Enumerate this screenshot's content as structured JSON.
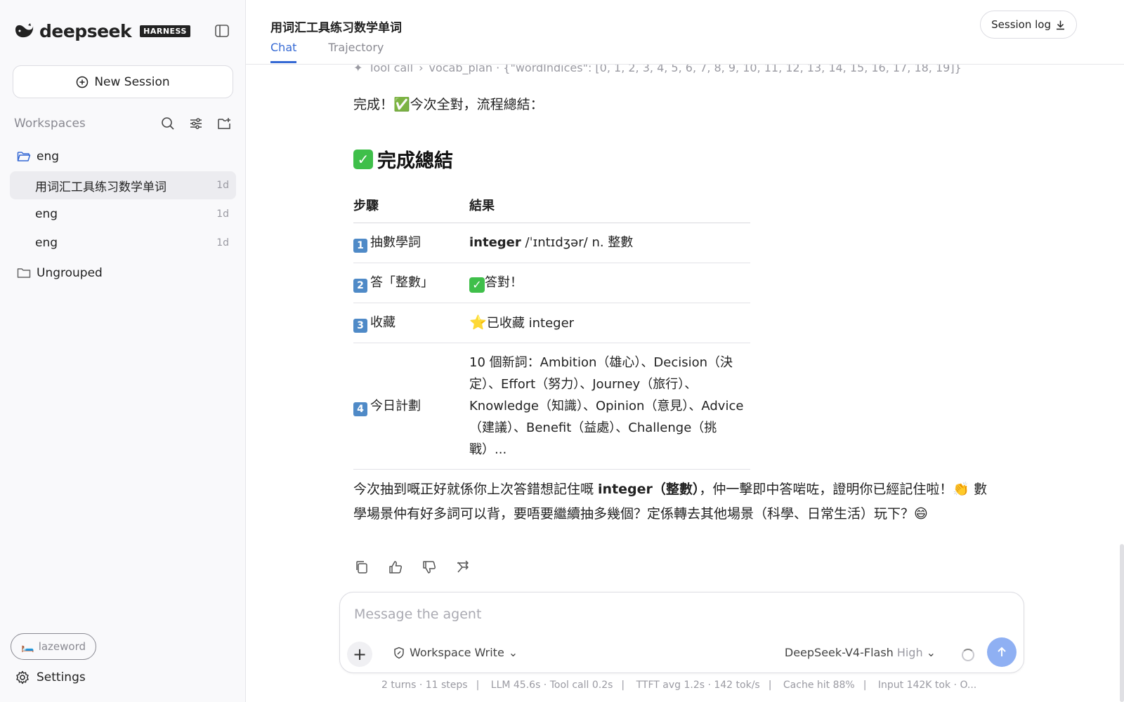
{
  "brand": {
    "name": "deepseek",
    "badge": "HARNESS"
  },
  "sidebar": {
    "new_session_label": "New Session",
    "workspaces_title": "Workspaces",
    "folders": [
      {
        "name": "eng",
        "sessions": [
          {
            "label": "用词汇工具练习数学单词",
            "age": "1d",
            "active": true
          },
          {
            "label": "eng",
            "age": "1d",
            "active": false
          },
          {
            "label": "eng",
            "age": "1d",
            "active": false
          }
        ]
      },
      {
        "name": "Ungrouped",
        "sessions": []
      }
    ],
    "user_chip": "lazeword",
    "settings_label": "Settings"
  },
  "header": {
    "title": "用词汇工具练习数学单词",
    "tabs": [
      "Chat",
      "Trajectory"
    ],
    "active_tab": "Chat",
    "session_log_label": "Session log"
  },
  "message": {
    "tool_line": {
      "label": "Tool call",
      "detail": "vocab_plan · {\"wordIndices\": [0, 1, 2, 3, 4, 5, 6, 7, 8, 9, 10, 11, 12, 13, 14, 15, 16, 17, 18, 19]}"
    },
    "intro_text": "完成！✅今次全對，流程總結：",
    "heading": "完成總結",
    "table": {
      "headers": [
        "步驟",
        "結果"
      ],
      "rows": [
        {
          "num": "1",
          "step": "抽數學詞",
          "result_bold": "integer",
          "result_rest": " /ˈɪntɪdʒər/ n. 整數"
        },
        {
          "num": "2",
          "step": "答「整數」",
          "result_prefix": "✅",
          "result_rest": "答對！"
        },
        {
          "num": "3",
          "step": "收藏",
          "result_prefix": "⭐",
          "result_rest": "已收藏 integer"
        },
        {
          "num": "4",
          "step": "今日計劃",
          "result_rest": "10 個新詞：Ambition（雄心）、Decision（決定）、Effort（努力）、Journey（旅行）、Knowledge（知識）、Opinion（意見）、Advice（建議）、Benefit（益處）、Challenge（挑戰）..."
        }
      ]
    },
    "closing_pre": "今次抽到嘅正好就係你上次答錯想記住嘅 ",
    "closing_bold": "integer（整數）",
    "closing_post": "，仲一擊即中答啱咗，證明你已經記住啦！👏 數學場景仲有好多詞可以背，要唔要繼續抽多幾個？定係轉去其他場景（科學、日常生活）玩下？😄"
  },
  "composer": {
    "placeholder": "Message the agent",
    "mode_label": "Workspace Write",
    "model": "DeepSeek-V4-Flash",
    "level": "High"
  },
  "stats": [
    "2 turns · 11 steps",
    "LLM 45.6s · Tool call 0.2s",
    "TTFT avg 1.2s · 142 tok/s",
    "Cache hit 88%",
    "Input 142K tok · O..."
  ],
  "colors": {
    "accent": "#3569d4",
    "send": "#8fb0f3",
    "check": "#3fbf4a"
  }
}
